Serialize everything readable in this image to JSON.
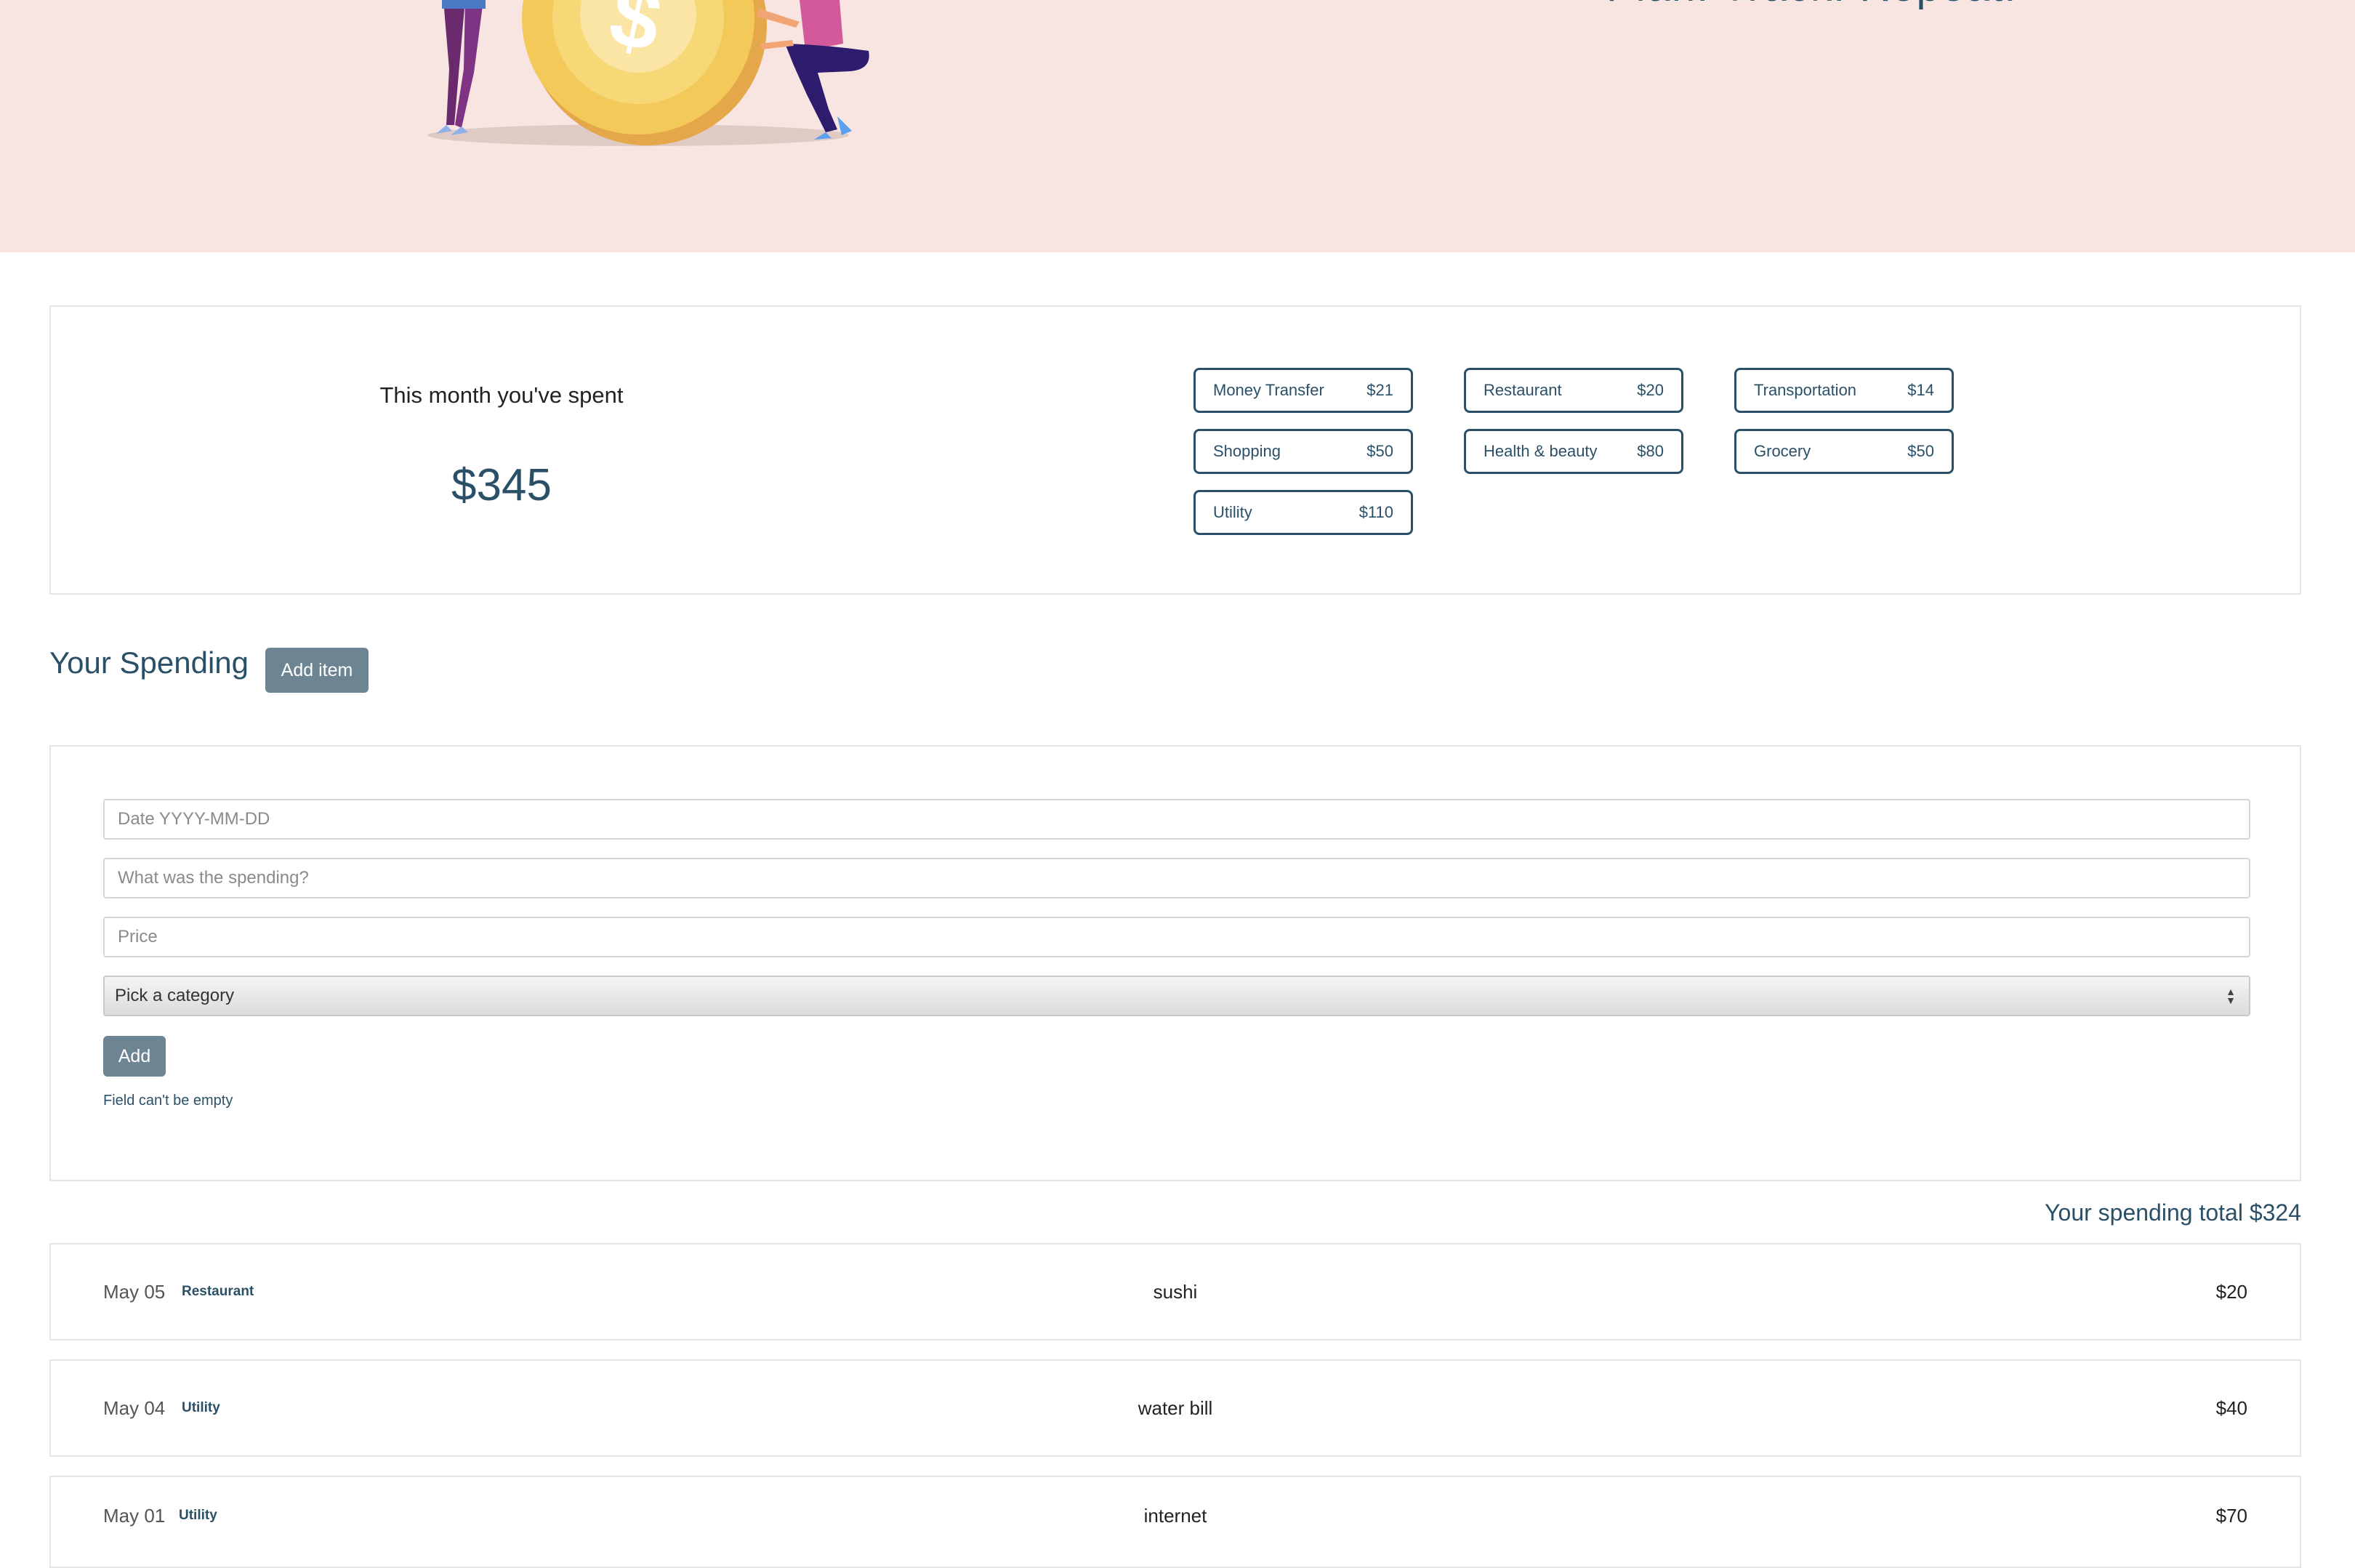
{
  "hero": {
    "tagline": "Plan. Track. Repeat."
  },
  "summary": {
    "label": "This month you've spent",
    "amount": "$345",
    "categories": [
      {
        "name": "Money Transfer",
        "amount": "$21"
      },
      {
        "name": "Restaurant",
        "amount": "$20"
      },
      {
        "name": "Transportation",
        "amount": "$14"
      },
      {
        "name": "Shopping",
        "amount": "$50"
      },
      {
        "name": "Health & beauty",
        "amount": "$80"
      },
      {
        "name": "Grocery",
        "amount": "$50"
      },
      {
        "name": "Utility",
        "amount": "$110"
      }
    ]
  },
  "spending": {
    "title": "Your Spending",
    "add_item_label": "Add item"
  },
  "form": {
    "date_placeholder": "Date YYYY-MM-DD",
    "description_placeholder": "What was the spending?",
    "price_placeholder": "Price",
    "category_selected": "Pick a category",
    "add_label": "Add",
    "error": "Field can't be empty"
  },
  "list": {
    "total": "Your spending total $324",
    "items": [
      {
        "date": "May 05",
        "category": "Restaurant",
        "description": "sushi",
        "price": "$20"
      },
      {
        "date": "May 04",
        "category": "Utility",
        "description": "water bill",
        "price": "$40"
      },
      {
        "date": "May 01",
        "category": "Utility",
        "description": "internet",
        "price": "$70"
      }
    ]
  },
  "colors": {
    "accent": "#2a5068",
    "hero_bg": "#f8e4e1",
    "button": "#6d8493",
    "coin": "#f3c95a"
  }
}
